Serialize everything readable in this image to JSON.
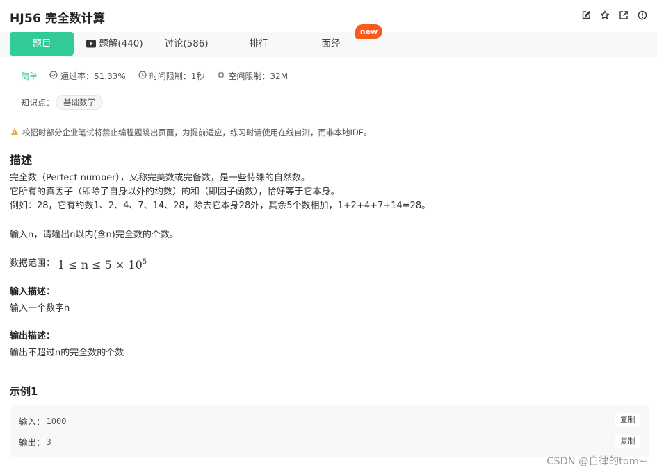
{
  "header": {
    "title": "HJ56  完全数计算",
    "icons": [
      "edit-icon",
      "star-icon",
      "share-icon",
      "info-icon"
    ]
  },
  "tabs": [
    {
      "label": "题目",
      "active": true
    },
    {
      "label": "题解(440)",
      "icon": "video-icon"
    },
    {
      "label": "讨论(586)"
    },
    {
      "label": "排行"
    },
    {
      "label": "面经"
    }
  ],
  "badge": "new",
  "meta": {
    "difficulty": "简单",
    "pass_rate": "通过率：51.33%",
    "time_limit": "时间限制：1秒",
    "space_limit": "空间限制：32M"
  },
  "knowledge": {
    "label": "知识点：",
    "tag": "基础数学"
  },
  "warning": "校招时部分企业笔试将禁止编程题跳出页面，为提前适应，练习时请使用在线自测，而非本地IDE。",
  "description": {
    "heading": "描述",
    "lines": [
      "完全数（Perfect number），又称完美数或完备数，是一些特殊的自然数。",
      "它所有的真因子（即除了自身以外的约数）的和（即因子函数），恰好等于它本身。",
      "例如：28，它有约数1、2、4、7、14、28，除去它本身28外，其余5个数相加，1+2+4+7+14=28。"
    ],
    "task": "输入n，请输出n以内(含n)完全数的个数。",
    "range_label": "数据范围：",
    "range_math": "1 ≤ n ≤ 5 × 10",
    "range_exp": "5"
  },
  "input_desc": {
    "heading": "输入描述：",
    "text": "输入一个数字n"
  },
  "output_desc": {
    "heading": "输出描述：",
    "text": "输出不超过n的完全数的个数"
  },
  "example": {
    "heading": "示例1",
    "input_label": "输入：",
    "input_value": "1000",
    "output_label": "输出：",
    "output_value": "3",
    "copy_label": "复制"
  },
  "watermark": "CSDN @自律的tom~",
  "colors": {
    "accent": "#32ca99",
    "badge": "#fa5a1e",
    "warning": "#f5a623"
  }
}
